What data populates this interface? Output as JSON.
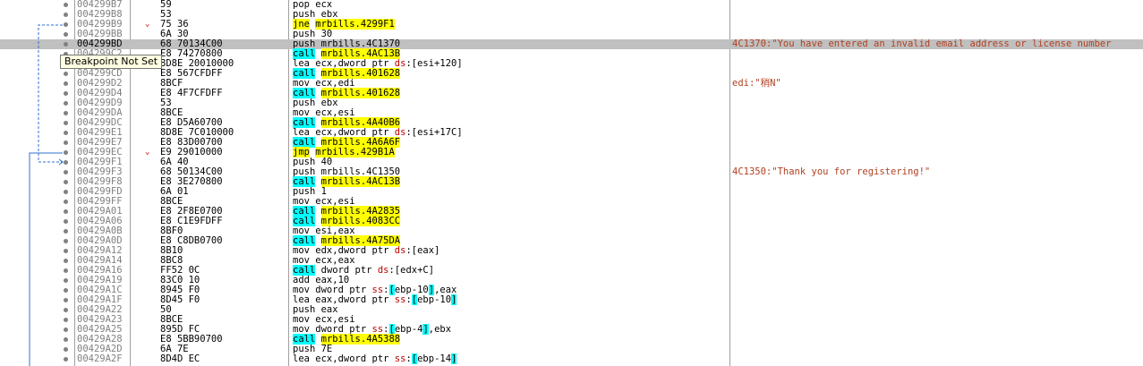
{
  "tooltip": "Breakpoint Not Set",
  "rows": [
    {
      "addr": "004299B7",
      "bytes": "59",
      "instr": [
        [
          "pop ecx",
          ""
        ]
      ],
      "comment": ""
    },
    {
      "addr": "004299B8",
      "bytes": "53",
      "instr": [
        [
          "push ebx",
          ""
        ]
      ],
      "comment": ""
    },
    {
      "addr": "004299B9",
      "bytes": "75 36",
      "mark": "⌄",
      "instr": [
        [
          "jne",
          "y"
        ],
        [
          " ",
          ""
        ],
        [
          "mrbills.4299F1",
          "y"
        ]
      ],
      "comment": ""
    },
    {
      "addr": "004299BB",
      "bytes": "6A 30",
      "instr": [
        [
          "push 30",
          ""
        ]
      ],
      "comment": ""
    },
    {
      "addr": "004299BD",
      "bytes": "68 70134C00",
      "selected": true,
      "instr": [
        [
          "push mrbills.4C1370",
          ""
        ]
      ],
      "comment": "4C1370:\"You have entered an invalid email address or license number"
    },
    {
      "addr": "004299C2",
      "bytes": "E8 74270800",
      "instr": [
        [
          "call",
          "c"
        ],
        [
          " ",
          ""
        ],
        [
          "mrbills.4AC13B",
          "y"
        ]
      ],
      "comment": ""
    },
    {
      "addr": "004299C7",
      "bytes": "8D8E 20010000",
      "instr": [
        [
          "lea ecx,dword ptr ",
          ""
        ],
        [
          "ds",
          "r"
        ],
        [
          ":[esi+120]",
          ""
        ]
      ],
      "comment": ""
    },
    {
      "addr": "004299CD",
      "bytes": "E8 567CFDFF",
      "instr": [
        [
          "call",
          "c"
        ],
        [
          " ",
          ""
        ],
        [
          "mrbills.401628",
          "y"
        ]
      ],
      "comment": ""
    },
    {
      "addr": "004299D2",
      "bytes": "8BCF",
      "instr": [
        [
          "mov ecx,edi",
          ""
        ]
      ],
      "comment": "edi:\"稍N\""
    },
    {
      "addr": "004299D4",
      "bytes": "E8 4F7CFDFF",
      "instr": [
        [
          "call",
          "c"
        ],
        [
          " ",
          ""
        ],
        [
          "mrbills.401628",
          "y"
        ]
      ],
      "comment": ""
    },
    {
      "addr": "004299D9",
      "bytes": "53",
      "instr": [
        [
          "push ebx",
          ""
        ]
      ],
      "comment": ""
    },
    {
      "addr": "004299DA",
      "bytes": "8BCE",
      "instr": [
        [
          "mov ecx,esi",
          ""
        ]
      ],
      "comment": ""
    },
    {
      "addr": "004299DC",
      "bytes": "E8 D5A60700",
      "instr": [
        [
          "call",
          "c"
        ],
        [
          " ",
          ""
        ],
        [
          "mrbills.4A40B6",
          "y"
        ]
      ],
      "comment": ""
    },
    {
      "addr": "004299E1",
      "bytes": "8D8E 7C010000",
      "instr": [
        [
          "lea ecx,dword ptr ",
          ""
        ],
        [
          "ds",
          "r"
        ],
        [
          ":[esi+17C]",
          ""
        ]
      ],
      "comment": ""
    },
    {
      "addr": "004299E7",
      "bytes": "E8 83D00700",
      "instr": [
        [
          "call",
          "c"
        ],
        [
          " ",
          ""
        ],
        [
          "mrbills.4A6A6F",
          "y"
        ]
      ],
      "comment": ""
    },
    {
      "addr": "004299EC",
      "bytes": "E9 29010000",
      "mark": "⌄",
      "instr": [
        [
          "jmp",
          "y"
        ],
        [
          " ",
          ""
        ],
        [
          "mrbills.429B1A",
          "y"
        ]
      ],
      "comment": ""
    },
    {
      "addr": "004299F1",
      "bytes": "6A 40",
      "instr": [
        [
          "push 40",
          ""
        ]
      ],
      "comment": ""
    },
    {
      "addr": "004299F3",
      "bytes": "68 50134C00",
      "instr": [
        [
          "push mrbills.4C1350",
          ""
        ]
      ],
      "comment": "4C1350:\"Thank you for registering!\""
    },
    {
      "addr": "004299F8",
      "bytes": "E8 3E270800",
      "instr": [
        [
          "call",
          "c"
        ],
        [
          " ",
          ""
        ],
        [
          "mrbills.4AC13B",
          "y"
        ]
      ],
      "comment": ""
    },
    {
      "addr": "004299FD",
      "bytes": "6A 01",
      "instr": [
        [
          "push 1",
          ""
        ]
      ],
      "comment": ""
    },
    {
      "addr": "004299FF",
      "bytes": "8BCE",
      "instr": [
        [
          "mov ecx,esi",
          ""
        ]
      ],
      "comment": ""
    },
    {
      "addr": "00429A01",
      "bytes": "E8 2F8E0700",
      "instr": [
        [
          "call",
          "c"
        ],
        [
          " ",
          ""
        ],
        [
          "mrbills.4A2835",
          "y"
        ]
      ],
      "comment": ""
    },
    {
      "addr": "00429A06",
      "bytes": "E8 C1E9FDFF",
      "instr": [
        [
          "call",
          "c"
        ],
        [
          " ",
          ""
        ],
        [
          "mrbills.4083CC",
          "y"
        ]
      ],
      "comment": ""
    },
    {
      "addr": "00429A0B",
      "bytes": "8BF0",
      "instr": [
        [
          "mov esi,eax",
          ""
        ]
      ],
      "comment": ""
    },
    {
      "addr": "00429A0D",
      "bytes": "E8 C8DB0700",
      "instr": [
        [
          "call",
          "c"
        ],
        [
          " ",
          ""
        ],
        [
          "mrbills.4A75DA",
          "y"
        ]
      ],
      "comment": ""
    },
    {
      "addr": "00429A12",
      "bytes": "8B10",
      "instr": [
        [
          "mov edx,dword ptr ",
          ""
        ],
        [
          "ds",
          "r"
        ],
        [
          ":[eax]",
          ""
        ]
      ],
      "comment": ""
    },
    {
      "addr": "00429A14",
      "bytes": "8BC8",
      "instr": [
        [
          "mov ecx,eax",
          ""
        ]
      ],
      "comment": ""
    },
    {
      "addr": "00429A16",
      "bytes": "FF52 0C",
      "instr": [
        [
          "call",
          "c"
        ],
        [
          " dword ptr ",
          ""
        ],
        [
          "ds",
          "r"
        ],
        [
          ":[edx+C]",
          ""
        ]
      ],
      "comment": ""
    },
    {
      "addr": "00429A19",
      "bytes": "83C0 10",
      "instr": [
        [
          "add eax,10",
          ""
        ]
      ],
      "comment": ""
    },
    {
      "addr": "00429A1C",
      "bytes": "8945 F0",
      "instr": [
        [
          "mov dword ptr ",
          ""
        ],
        [
          "ss",
          "r"
        ],
        [
          ":",
          ""
        ],
        [
          "[",
          "b"
        ],
        [
          "ebp-10",
          ""
        ],
        [
          "]",
          "b"
        ],
        [
          ",eax",
          ""
        ]
      ],
      "comment": ""
    },
    {
      "addr": "00429A1F",
      "bytes": "8D45 F0",
      "instr": [
        [
          "lea eax,dword ptr ",
          ""
        ],
        [
          "ss",
          "r"
        ],
        [
          ":",
          ""
        ],
        [
          "[",
          "b"
        ],
        [
          "ebp-10",
          ""
        ],
        [
          "]",
          "b"
        ]
      ],
      "comment": ""
    },
    {
      "addr": "00429A22",
      "bytes": "50",
      "instr": [
        [
          "push eax",
          ""
        ]
      ],
      "comment": ""
    },
    {
      "addr": "00429A23",
      "bytes": "8BCE",
      "instr": [
        [
          "mov ecx,esi",
          ""
        ]
      ],
      "comment": ""
    },
    {
      "addr": "00429A25",
      "bytes": "895D FC",
      "instr": [
        [
          "mov dword ptr ",
          ""
        ],
        [
          "ss",
          "r"
        ],
        [
          ":",
          ""
        ],
        [
          "[",
          "b"
        ],
        [
          "ebp-4",
          ""
        ],
        [
          "]",
          "b"
        ],
        [
          ",ebx",
          ""
        ]
      ],
      "comment": ""
    },
    {
      "addr": "00429A28",
      "bytes": "E8 5BB90700",
      "instr": [
        [
          "call",
          "c"
        ],
        [
          " ",
          ""
        ],
        [
          "mrbills.4A5388",
          "y"
        ]
      ],
      "comment": ""
    },
    {
      "addr": "00429A2D",
      "bytes": "6A 7E",
      "instr": [
        [
          "push 7E",
          ""
        ]
      ],
      "comment": ""
    },
    {
      "addr": "00429A2F",
      "bytes": "8D4D EC",
      "instr": [
        [
          "lea ecx,dword ptr ",
          ""
        ],
        [
          "ss",
          "r"
        ],
        [
          ":",
          ""
        ],
        [
          "[",
          "b"
        ],
        [
          "ebp-14",
          ""
        ],
        [
          "]",
          "b"
        ]
      ],
      "comment": ""
    }
  ]
}
